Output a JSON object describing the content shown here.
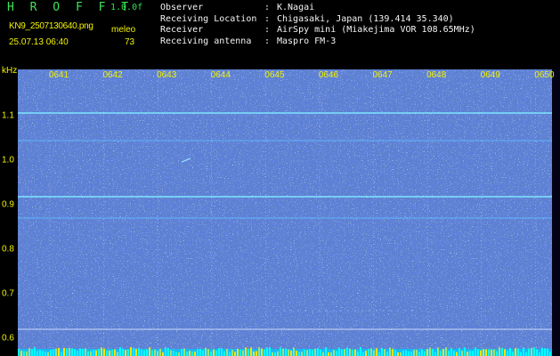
{
  "app": {
    "title": "H R O F F T",
    "version": "1.0.0f",
    "filename": "KN9_2507130640.png",
    "datetime": "25.07.13 06:40",
    "meleo_label": "meleo",
    "meleo_value": "73"
  },
  "info": [
    {
      "key": "Observer",
      "value": "K.Nagai"
    },
    {
      "key": "Receiving Location",
      "value": "Chigasaki, Japan (139.414 35.340)"
    },
    {
      "key": "Receiver",
      "value": "AirSpy mini (Miakejima VOR 108.65MHz)"
    },
    {
      "key": "Receiving antenna",
      "value": "Maspro FM-3"
    }
  ],
  "axes": {
    "y_unit": "kHz",
    "y_ticks": [
      "1.1",
      "1.0",
      "0.9",
      "0.8",
      "0.7",
      "0.6"
    ],
    "time_ticks": [
      "0641",
      "0642",
      "0643",
      "0644",
      "0645",
      "0646",
      "0647",
      "0648",
      "0649",
      "0650"
    ]
  },
  "colors": {
    "background": "#000000",
    "spectrogram_bg": "#0a0f6e",
    "label_yellow": "#f2f200",
    "title_green": "#3fe35a",
    "carrier_line": "#7fd4ff",
    "bottom_band": "#00ffff"
  }
}
